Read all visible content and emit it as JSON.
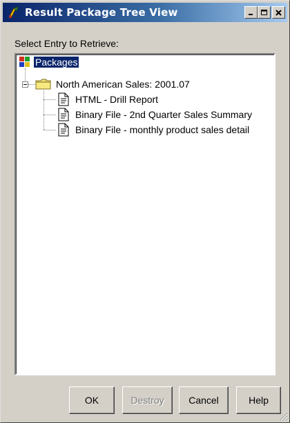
{
  "window": {
    "title": "Result Package Tree View",
    "controls": {
      "minimize": "_",
      "maximize": "□",
      "close": "✕"
    }
  },
  "prompt_label": "Select Entry to Retrieve:",
  "tree": {
    "root": {
      "label": "Packages",
      "icon": "packages-icon",
      "selected": true
    },
    "folder": {
      "label": "North American Sales: 2001.07",
      "icon": "folder-icon",
      "expanded": true
    },
    "items": [
      {
        "label": "HTML - Drill Report",
        "icon": "document-icon"
      },
      {
        "label": "Binary File - 2nd Quarter Sales Summary",
        "icon": "document-icon"
      },
      {
        "label": "Binary File - monthly product sales detail",
        "icon": "document-icon"
      }
    ]
  },
  "buttons": {
    "ok": "OK",
    "destroy": "Destroy",
    "cancel": "Cancel",
    "help": "Help"
  },
  "colors": {
    "titlebar_start": "#0a246a",
    "titlebar_end": "#a6caf0",
    "face": "#d4d0c8",
    "selection": "#0a246a"
  }
}
